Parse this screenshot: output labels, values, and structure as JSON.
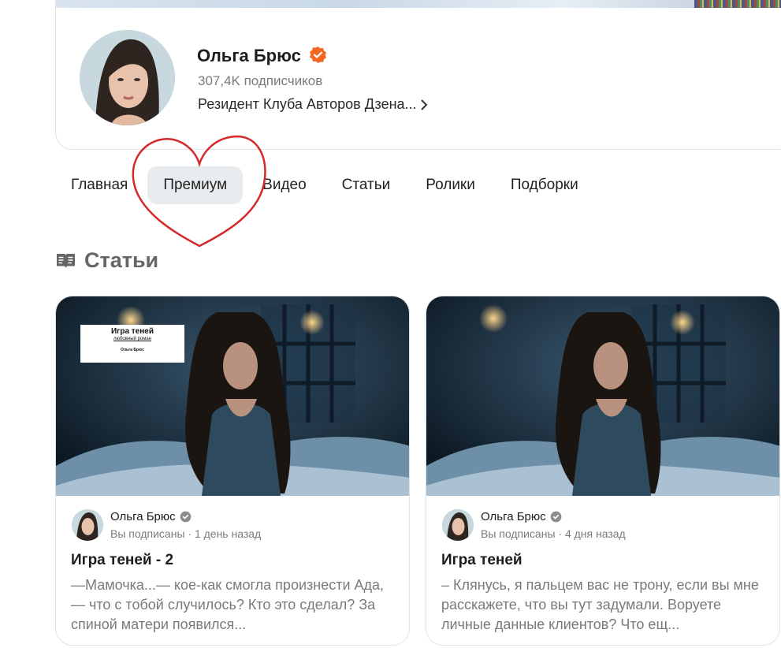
{
  "profile": {
    "name": "Ольга Брюс",
    "subscribers": "307,4K подписчиков",
    "resident": "Резидент Клуба Авторов Дзена..."
  },
  "tabs": [
    {
      "label": "Главная",
      "active": false
    },
    {
      "label": "Премиум",
      "active": true
    },
    {
      "label": "Видео",
      "active": false
    },
    {
      "label": "Статьи",
      "active": false
    },
    {
      "label": "Ролики",
      "active": false
    },
    {
      "label": "Подборки",
      "active": false
    }
  ],
  "section": {
    "title": "Статьи",
    "icon": "articles-icon"
  },
  "cards": [
    {
      "cover": {
        "title": "Игра теней",
        "subtitle": "любовный роман",
        "author": "Ольга Брюс"
      },
      "author": "Ольга Брюс",
      "meta": "Вы подписаны · 1 день назад",
      "title": "Игра теней - 2",
      "snippet": "—Мамочка...— кое-как смогла произнести Ада, — что с тобой случилось? Кто это сделал? За спиной матери появился..."
    },
    {
      "author": "Ольга Брюс",
      "meta": "Вы подписаны · 4 дня назад",
      "title": "Игра теней",
      "snippet": "– Клянусь, я пальцем вас не трону, если вы мне расскажете, что вы тут задумали. Воруете личные данные клиентов? Что ещ..."
    }
  ],
  "colors": {
    "accent": "#f26822",
    "active_tab": "#e9ecef",
    "heart": "#d42a2a",
    "muted_text": "#7a7a7a"
  }
}
